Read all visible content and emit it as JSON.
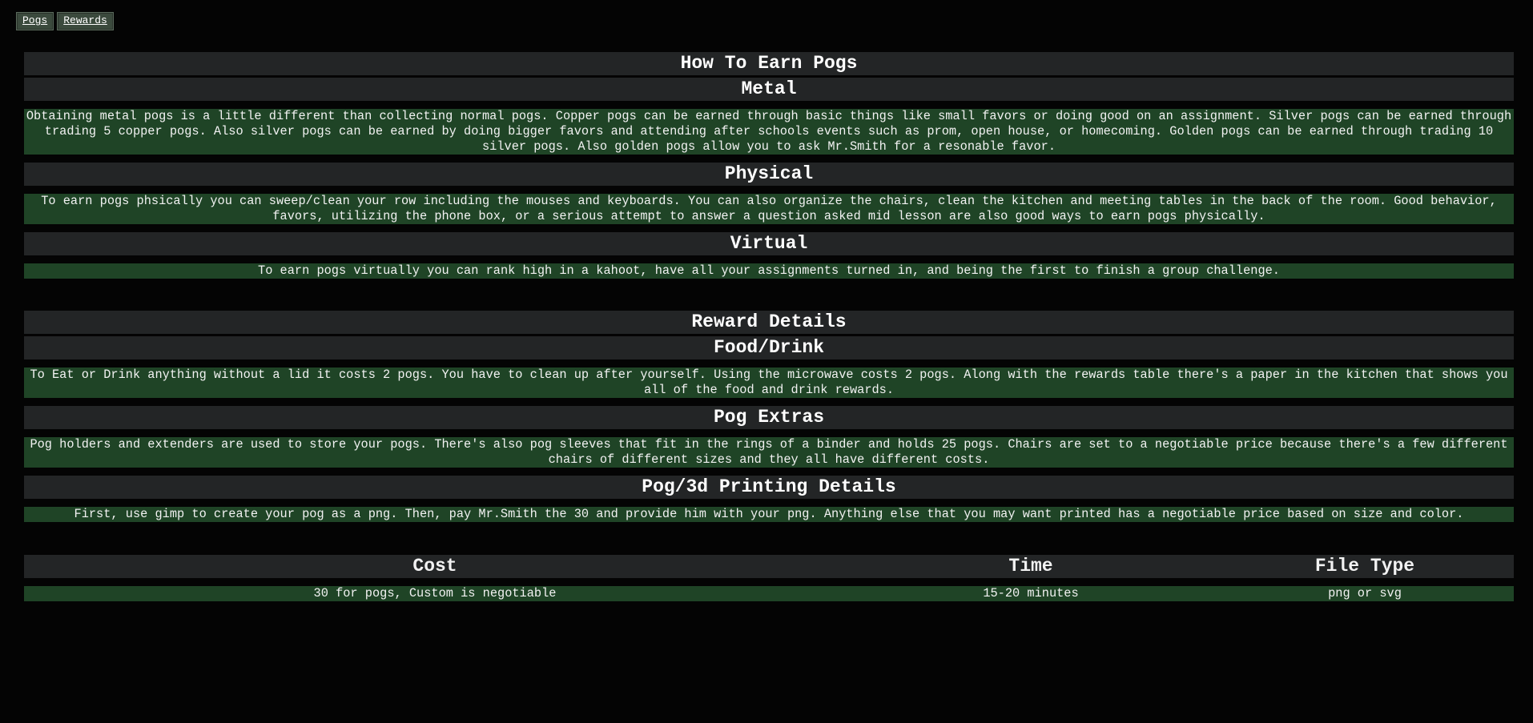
{
  "nav": {
    "pogs_label": "Pogs",
    "rewards_label": "Rewards"
  },
  "earn": {
    "title": "How To Earn Pogs",
    "sections": [
      {
        "heading": "Metal",
        "text": "Obtaining metal pogs is a little different than collecting normal pogs. Copper pogs can be earned through basic things like small favors or doing good on an assignment. Silver pogs can be earned through trading 5 copper pogs. Also silver pogs can be earned by doing bigger favors and attending after schools events such as prom, open house, or homecoming. Golden pogs can be earned through trading 10 silver pogs. Also golden pogs allow you to ask Mr.Smith for a resonable favor."
      },
      {
        "heading": "Physical",
        "text": "To earn pogs phsically you can sweep/clean your row including the mouses and keyboards. You can also organize the chairs, clean the kitchen and meeting tables in the back of the room. Good behavior, favors, utilizing the phone box, or a serious attempt to answer a question asked mid lesson are also good ways to earn pogs physically."
      },
      {
        "heading": "Virtual",
        "text": "To earn pogs virtually you can rank high in a kahoot, have all your assignments turned in, and being the first to finish a group challenge."
      }
    ]
  },
  "rewards": {
    "title": "Reward Details",
    "sections": [
      {
        "heading": "Food/Drink",
        "text": "To Eat or Drink anything without a lid it costs 2 pogs. You have to clean up after yourself. Using the microwave costs 2 pogs. Along with the rewards table there's a paper in the kitchen that shows you all of the food and drink rewards."
      },
      {
        "heading": "Pog Extras",
        "text": "Pog holders and extenders are used to store your pogs. There's also pog sleeves that fit in the rings of a binder and holds 25 pogs. Chairs are set to a negotiable price because there's a few different chairs of different sizes and they all have different costs."
      },
      {
        "heading": "Pog/3d Printing Details",
        "text": "First, use gimp to create your pog as a png. Then, pay Mr.Smith the 30 and provide him with your png. Anything else that you may want printed has a negotiable price based on size and color."
      }
    ]
  },
  "printing_table": {
    "headers": [
      "Cost",
      "Time",
      "File Type"
    ],
    "row": [
      "30 for pogs, Custom is negotiable",
      "15-20 minutes",
      "png or svg"
    ]
  },
  "colors": {
    "background": "#040404",
    "header_bg": "#232526",
    "body_bg": "#1f4426",
    "nav_bg": "#3b4a3d"
  }
}
